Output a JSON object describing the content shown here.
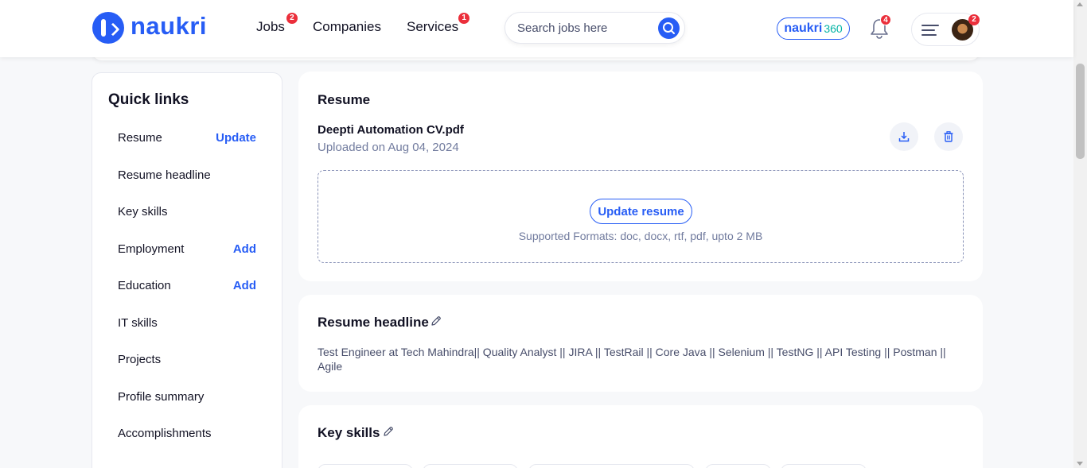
{
  "header": {
    "logo_text": "naukri",
    "nav": [
      {
        "label": "Jobs",
        "badge": "2"
      },
      {
        "label": "Companies"
      },
      {
        "label": "Services",
        "badge": "1"
      }
    ],
    "search_placeholder": "Search jobs here",
    "naukri360": {
      "brand": "naukri",
      "suffix": "360"
    },
    "notification_badge": "4",
    "profile_badge": "2"
  },
  "quick_links": {
    "title": "Quick links",
    "items": [
      {
        "label": "Resume",
        "action": "Update"
      },
      {
        "label": "Resume headline"
      },
      {
        "label": "Key skills"
      },
      {
        "label": "Employment",
        "action": "Add"
      },
      {
        "label": "Education",
        "action": "Add"
      },
      {
        "label": "IT skills"
      },
      {
        "label": "Projects"
      },
      {
        "label": "Profile summary"
      },
      {
        "label": "Accomplishments"
      }
    ]
  },
  "resume": {
    "title": "Resume",
    "file_name": "Deepti Automation CV.pdf",
    "uploaded": "Uploaded on Aug 04, 2024",
    "update_button": "Update resume",
    "formats": "Supported Formats: doc, docx, rtf, pdf, upto 2 MB"
  },
  "resume_headline": {
    "title": "Resume headline",
    "text": "Test Engineer at Tech Mahindra|| Quality Analyst || JIRA || TestRail || Core Java || Selenium || TestNG || API Testing || Postman || Agile"
  },
  "key_skills": {
    "title": "Key skills"
  },
  "colors": {
    "brand_blue": "#275df5",
    "badge_red": "#eb2f3b",
    "teal": "#02b3a4"
  }
}
